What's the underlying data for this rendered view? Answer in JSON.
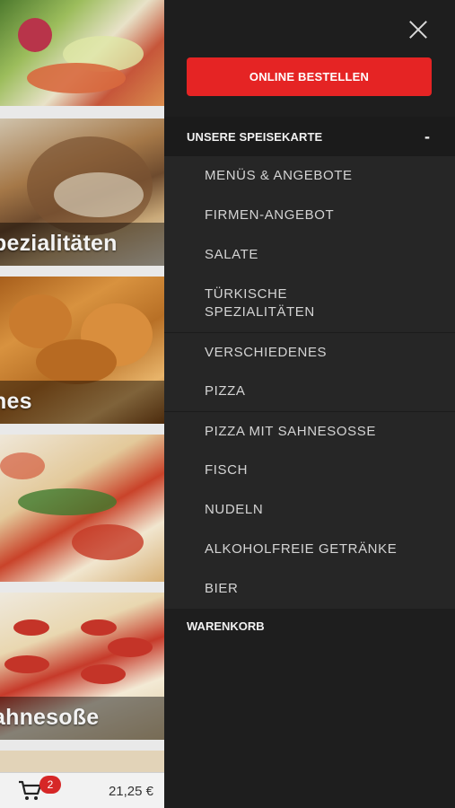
{
  "background": {
    "tiles": [
      {
        "caption": ""
      },
      {
        "caption": "pezialitäten"
      },
      {
        "caption": "nes"
      },
      {
        "caption": ""
      },
      {
        "caption": "ahnesoße"
      },
      {
        "caption": ""
      }
    ]
  },
  "cart": {
    "icon": "cart-icon",
    "badge": "2",
    "total": "21,25 €"
  },
  "drawer": {
    "close_icon": "close-icon",
    "order_button": "ONLINE BESTELLEN",
    "section_title": "UNSERE SPEISEKARTE",
    "section_toggle": "-",
    "items": [
      "MENÜS & ANGEBOTE",
      "FIRMEN-ANGEBOT",
      "SALATE",
      "TÜRKISCHE\nSPEZIALITÄTEN",
      "VERSCHIEDENES",
      "PIZZA",
      "PIZZA MIT SAHNESOSSE",
      "FISCH",
      "NUDELN",
      "ALKOHOLFREIE GETRÄNKE",
      "BIER"
    ],
    "cart_link": "WARENKORB"
  },
  "colors": {
    "accent": "#e52424",
    "drawer_bg": "#1e1e1e",
    "submenu_bg": "#262626",
    "badge": "#d62727"
  }
}
